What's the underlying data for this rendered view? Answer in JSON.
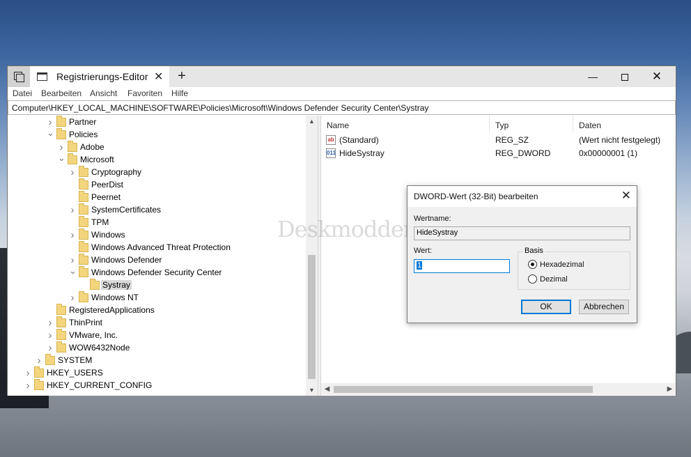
{
  "window": {
    "tab_title": "Registrierungs-Editor",
    "tab_close": "✕",
    "new_tab": "+",
    "minimize": "—",
    "close": "✕"
  },
  "menu": [
    "Datei",
    "Bearbeiten",
    "Ansicht",
    "Favoriten",
    "Hilfe"
  ],
  "address": "Computer\\HKEY_LOCAL_MACHINE\\SOFTWARE\\Policies\\Microsoft\\Windows Defender Security Center\\Systray",
  "tree": [
    {
      "label": "Partner",
      "level": 3,
      "state": "collapsed"
    },
    {
      "label": "Policies",
      "level": 3,
      "state": "expanded"
    },
    {
      "label": "Adobe",
      "level": 4,
      "state": "collapsed"
    },
    {
      "label": "Microsoft",
      "level": 4,
      "state": "expanded"
    },
    {
      "label": "Cryptography",
      "level": 5,
      "state": "collapsed"
    },
    {
      "label": "PeerDist",
      "level": 5,
      "state": "none"
    },
    {
      "label": "Peernet",
      "level": 5,
      "state": "none"
    },
    {
      "label": "SystemCertificates",
      "level": 5,
      "state": "collapsed"
    },
    {
      "label": "TPM",
      "level": 5,
      "state": "none"
    },
    {
      "label": "Windows",
      "level": 5,
      "state": "collapsed"
    },
    {
      "label": "Windows Advanced Threat Protection",
      "level": 5,
      "state": "none"
    },
    {
      "label": "Windows Defender",
      "level": 5,
      "state": "collapsed"
    },
    {
      "label": "Windows Defender Security Center",
      "level": 5,
      "state": "expanded"
    },
    {
      "label": "Systray",
      "level": 6,
      "state": "none",
      "selected": true
    },
    {
      "label": "Windows NT",
      "level": 5,
      "state": "collapsed"
    },
    {
      "label": "RegisteredApplications",
      "level": 3,
      "state": "none"
    },
    {
      "label": "ThinPrint",
      "level": 3,
      "state": "collapsed"
    },
    {
      "label": "VMware, Inc.",
      "level": 3,
      "state": "collapsed"
    },
    {
      "label": "WOW6432Node",
      "level": 3,
      "state": "collapsed"
    },
    {
      "label": "SYSTEM",
      "level": 2,
      "state": "collapsed"
    },
    {
      "label": "HKEY_USERS",
      "level": 1,
      "state": "collapsed"
    },
    {
      "label": "HKEY_CURRENT_CONFIG",
      "level": 1,
      "state": "collapsed"
    }
  ],
  "list": {
    "columns": [
      "Name",
      "Typ",
      "Daten"
    ],
    "rows": [
      {
        "icon": "ab",
        "name": "(Standard)",
        "type": "REG_SZ",
        "data": "(Wert nicht festgelegt)"
      },
      {
        "icon": "011",
        "name": "HideSystray",
        "type": "REG_DWORD",
        "data": "0x00000001 (1)"
      }
    ]
  },
  "watermark": "Deskmodder.de",
  "dialog": {
    "title": "DWORD-Wert (32-Bit) bearbeiten",
    "close": "✕",
    "name_label": "Wertname:",
    "name_value": "HideSystray",
    "value_label": "Wert:",
    "value": "1",
    "basis_label": "Basis",
    "radio_hex": "Hexadezimal",
    "radio_dec": "Dezimal",
    "ok": "OK",
    "cancel": "Abbrechen"
  }
}
